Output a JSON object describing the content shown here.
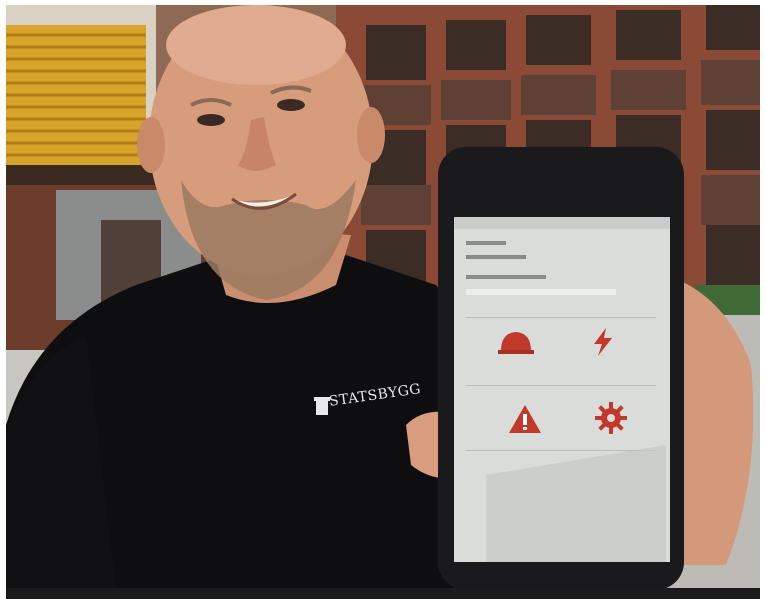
{
  "shirt": {
    "brand": "STATSBYGG"
  },
  "phone": {
    "app_tiles": [
      {
        "icon": "hard-hat-icon"
      },
      {
        "icon": "lightning-icon"
      },
      {
        "icon": "warning-icon"
      },
      {
        "icon": "gear-icon"
      }
    ]
  },
  "colors": {
    "brick": "#8a4a36",
    "shirt": "#0e0e10",
    "icon_red": "#c0392b",
    "screen_bg": "#d9dcd9"
  }
}
